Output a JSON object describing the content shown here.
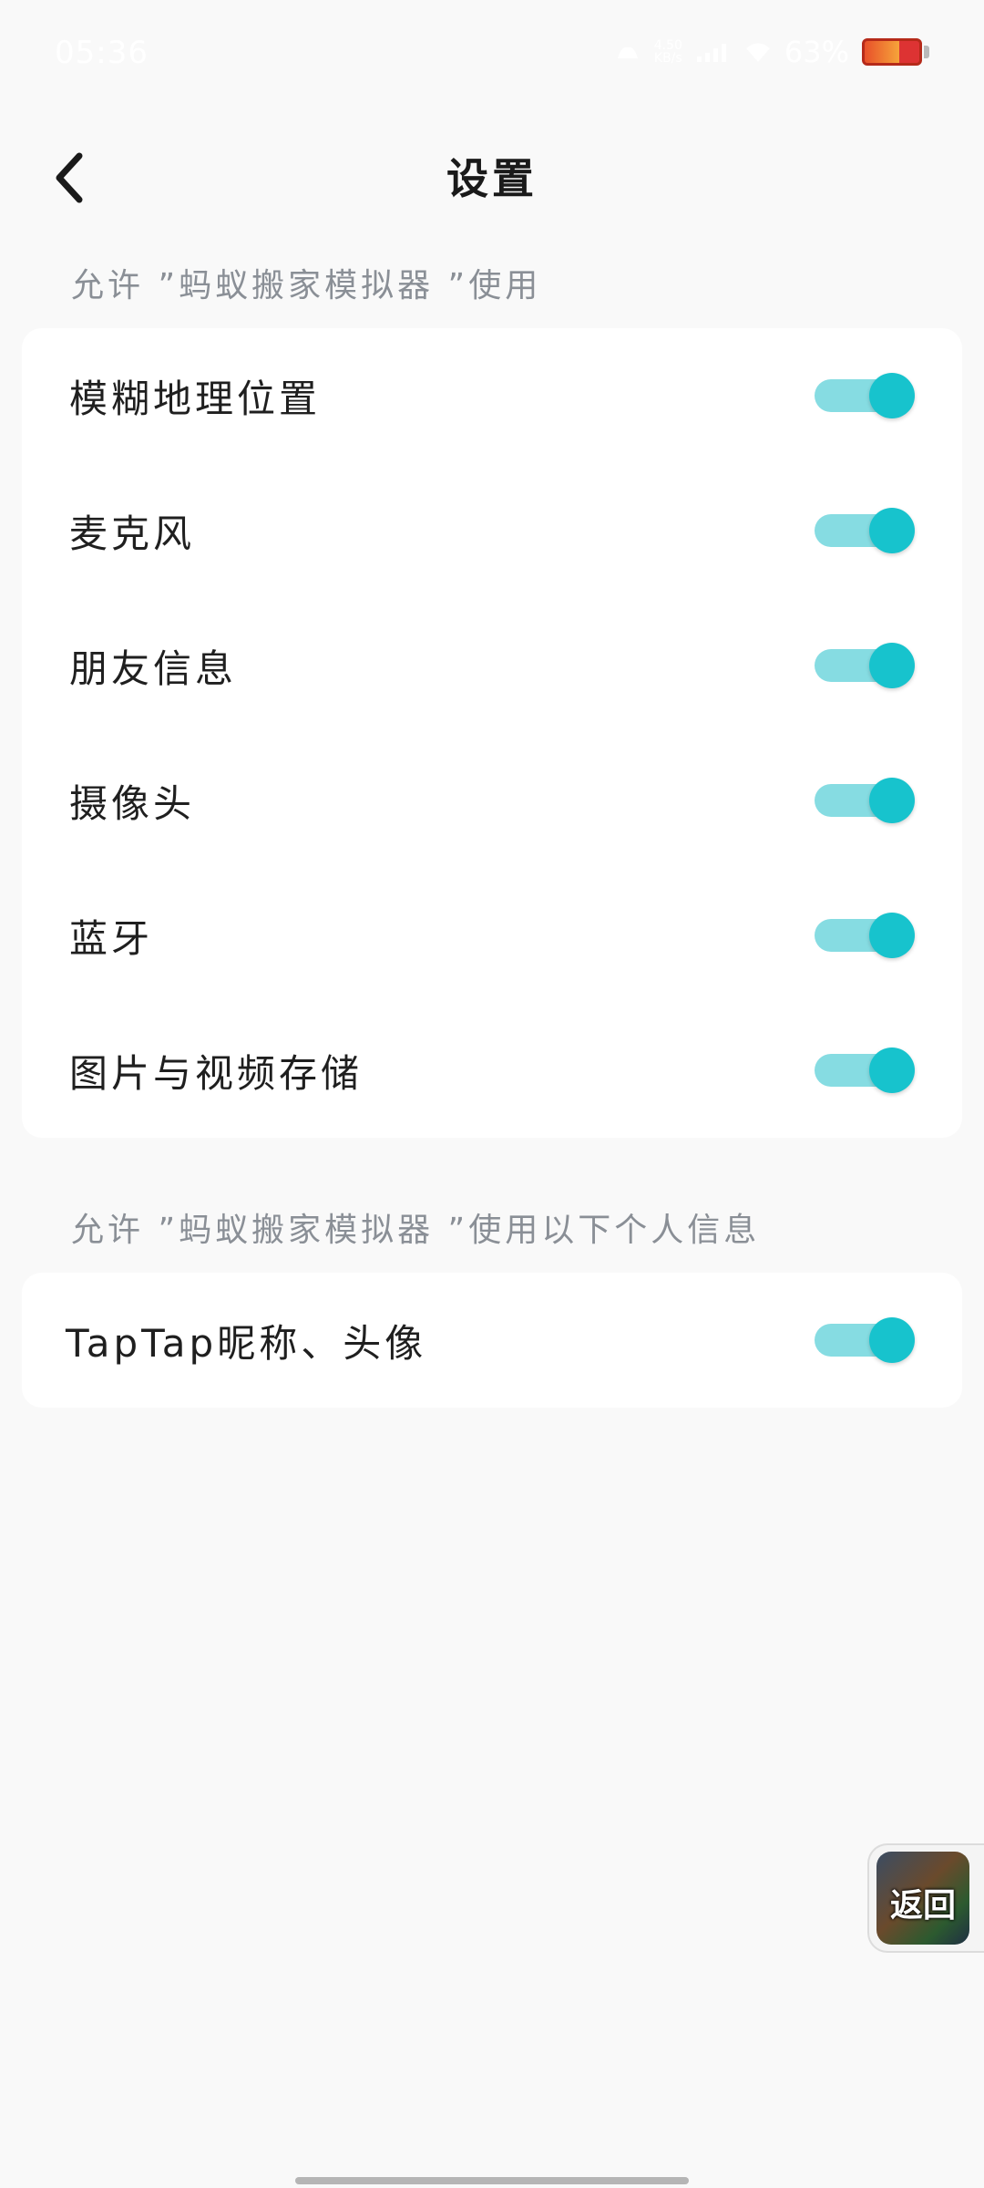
{
  "status_bar": {
    "time": "05:36",
    "net_speed_top": "4.50",
    "net_speed_bottom": "KB/s",
    "battery_percent": "63%",
    "battery_level": 0.63
  },
  "header": {
    "title": "设置"
  },
  "permissions_section": {
    "label": "允许 ”蚂蚁搬家模拟器 ”使用",
    "items": [
      {
        "label": "模糊地理位置",
        "enabled": true
      },
      {
        "label": "麦克风",
        "enabled": true
      },
      {
        "label": "朋友信息",
        "enabled": true
      },
      {
        "label": "摄像头",
        "enabled": true
      },
      {
        "label": "蓝牙",
        "enabled": true
      },
      {
        "label": "图片与视频存储",
        "enabled": true
      }
    ]
  },
  "personal_section": {
    "label": "允许 ”蚂蚁搬家模拟器 ”使用以下个人信息",
    "items": [
      {
        "label": "TapTap昵称、头像",
        "enabled": true
      }
    ]
  },
  "float_button": {
    "label": "返回"
  },
  "colors": {
    "toggle_on": "#17c3cd",
    "toggle_track": "#86dce2",
    "background": "#f9f9f9",
    "card": "#ffffff",
    "section_label": "#8a8f96"
  }
}
